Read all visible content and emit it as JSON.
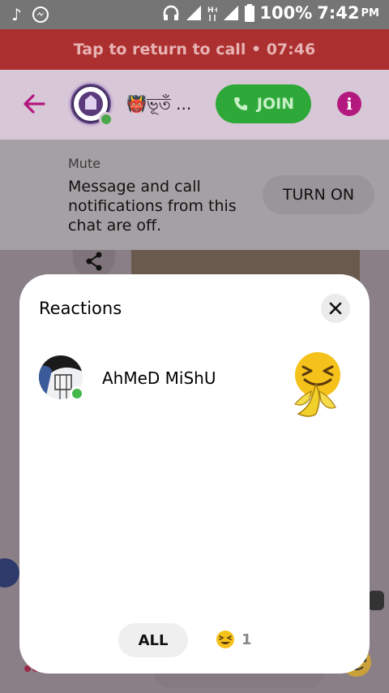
{
  "status_bar": {
    "battery": "100%",
    "time": "7:42",
    "ampm": "PM",
    "icons": [
      "music-note-icon",
      "messenger-icon",
      "headset-icon",
      "signal-icon",
      "hplus-icon",
      "battery-icon"
    ]
  },
  "call_banner": {
    "text": "Tap to return to call • 07:46"
  },
  "chat_header": {
    "title": "👹ভূতঁ ...",
    "join_label": "JOIN",
    "info_label": "i"
  },
  "mute_banner": {
    "label": "Mute",
    "message": "Message and call notifications from this chat are off.",
    "button_label": "TURN ON"
  },
  "reactions_sheet": {
    "title": "Reactions",
    "reactions": [
      {
        "user": "AhMeD MiShU",
        "emoji": "squinting-laugh-banana"
      }
    ],
    "tabs": {
      "all_label": "ALL",
      "emoji_count": "1"
    }
  },
  "colors": {
    "call_banner": "#ad3030",
    "join_button": "#2fa83a",
    "accent": "#b3187f",
    "online": "#44b84a"
  }
}
